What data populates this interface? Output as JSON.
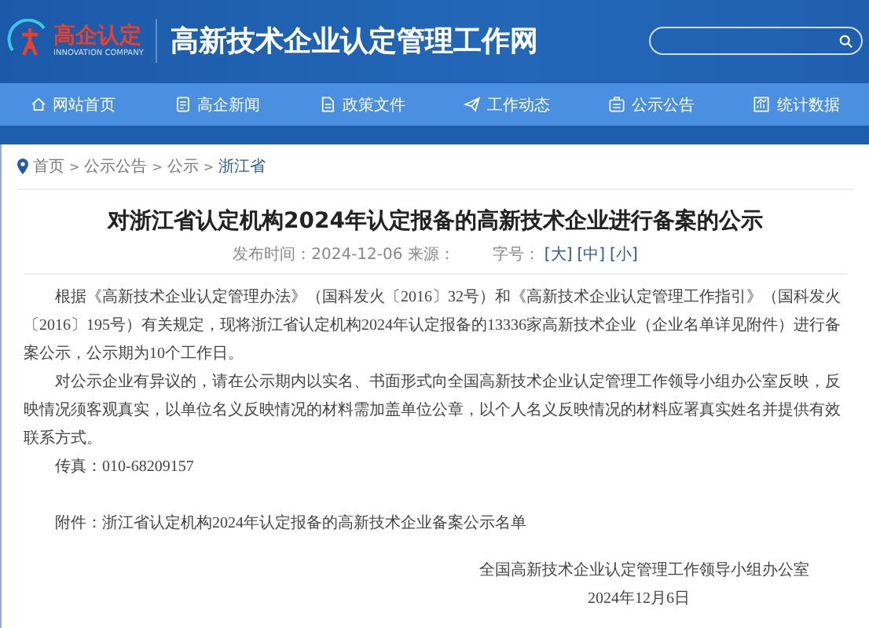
{
  "header": {
    "logo_text": "高企认定",
    "logo_subtext": "INNOVATION COMPANY",
    "site_title": "高新技术企业认定管理工作网"
  },
  "nav": [
    {
      "label": "网站首页",
      "kind": "home"
    },
    {
      "label": "高企新闻",
      "kind": "news"
    },
    {
      "label": "政策文件",
      "kind": "doc"
    },
    {
      "label": "工作动态",
      "kind": "plane"
    },
    {
      "label": "公示公告",
      "kind": "board"
    },
    {
      "label": "统计数据",
      "kind": "chart"
    }
  ],
  "breadcrumb": {
    "separator": ">",
    "items": [
      {
        "label": "首页",
        "selected": false
      },
      {
        "label": "公示公告",
        "selected": false
      },
      {
        "label": "公示",
        "selected": false
      },
      {
        "label": "浙江省",
        "selected": true
      }
    ]
  },
  "article": {
    "title": "对浙江省认定机构2024年认定报备的高新技术企业进行备案的公示",
    "meta": "发布时间：2024-12-06 来源：",
    "font_size_label": "字号：",
    "font_sizes": [
      "[大]",
      "[中]",
      "[小]"
    ],
    "paragraphs": [
      "根据《高新技术企业认定管理办法》（国科发火〔2016〕32号）和《高新技术企业认定管理工作指引》（国科发火〔2016〕195号）有关规定，现将浙江省认定机构2024年认定报备的13336家高新技术企业（企业名单详见附件）进行备案公示，公示期为10个工作日。",
      "对公示企业有异议的，请在公示期内以实名、书面形式向全国高新技术企业认定管理工作领导小组办公室反映，反映情况须客观真实，以单位名义反映情况的材料需加盖单位公章，以个人名义反映情况的材料应署真实姓名并提供有效联系方式。",
      "传真：010-68209157"
    ],
    "attachment": "附件：浙江省认定机构2024年认定报备的高新技术企业备案公示名单",
    "signature": "全国高新技术企业认定管理工作领导小组办公室",
    "date": "2024年12月6日"
  }
}
